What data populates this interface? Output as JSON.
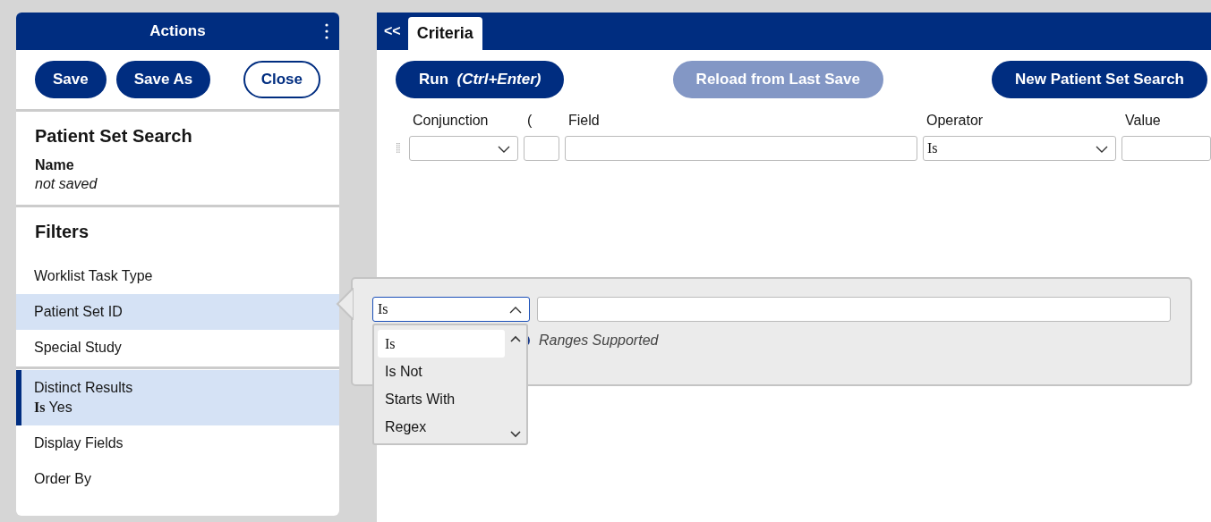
{
  "actions_panel": {
    "title": "Actions",
    "buttons": [
      {
        "label": "Save",
        "kind": "primary"
      },
      {
        "label": "Save As",
        "kind": "primary"
      },
      {
        "label": "Close",
        "kind": "outline"
      }
    ],
    "search": {
      "title": "Patient Set Search",
      "name_label": "Name",
      "name_value": "not saved"
    },
    "filters": {
      "title": "Filters",
      "groups": [
        [
          {
            "label": "Worklist Task Type",
            "selected": false,
            "applied": false
          },
          {
            "label": "Patient Set ID",
            "selected": true,
            "applied": false
          },
          {
            "label": "Special Study",
            "selected": false,
            "applied": false
          }
        ],
        [
          {
            "label": "Distinct Results",
            "detail": "**Is** Yes",
            "selected": false,
            "applied": true
          },
          {
            "label": "Display Fields",
            "selected": false,
            "applied": false
          },
          {
            "label": "Order By",
            "selected": false,
            "applied": false
          }
        ]
      ]
    }
  },
  "criteria_panel": {
    "collapse": "<<",
    "tabs": [
      {
        "label": "Criteria",
        "selected": true
      }
    ],
    "buttons": [
      {
        "label": "Run",
        "hint": "(Ctrl+Enter)",
        "disabled": false
      },
      {
        "label": "Reload from Last Save",
        "disabled": true
      },
      {
        "label": "New Patient Set Search",
        "disabled": false
      }
    ],
    "columns": [
      "Conjunction",
      "(",
      "Field",
      "Operator",
      "Value"
    ],
    "row": {
      "operator": "Is"
    }
  },
  "popover": {
    "operator": "Is",
    "hint": "Ranges Supported",
    "options": [
      {
        "label": "Is",
        "selected": true
      },
      {
        "label": "Is Not",
        "selected": false
      },
      {
        "label": "Starts With",
        "selected": false
      },
      {
        "label": "Regex",
        "selected": false
      }
    ]
  }
}
